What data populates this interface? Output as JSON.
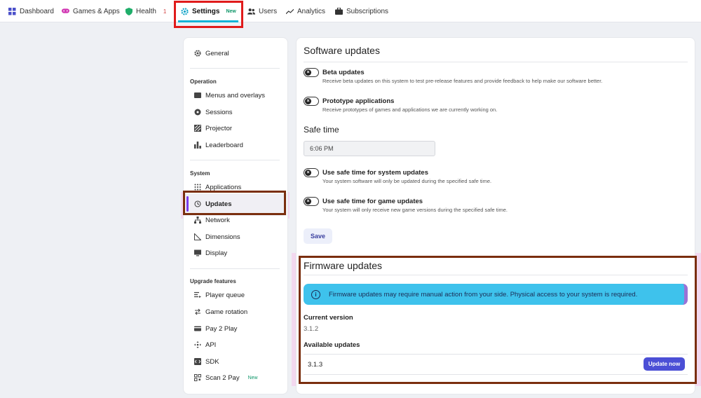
{
  "nav": {
    "items": [
      {
        "label": "Dashboard",
        "icon": "grid-icon"
      },
      {
        "label": "Games & Apps",
        "icon": "gamepad-icon"
      },
      {
        "label": "Health",
        "icon": "shield-icon",
        "count": "1"
      },
      {
        "label": "Settings",
        "icon": "gear-icon",
        "badge": "New"
      },
      {
        "label": "Users",
        "icon": "users-icon"
      },
      {
        "label": "Analytics",
        "icon": "trend-icon"
      },
      {
        "label": "Subscriptions",
        "icon": "briefcase-icon"
      }
    ]
  },
  "sidebar": {
    "general": "General",
    "sections": {
      "operation": "Operation",
      "system": "System",
      "upgrade": "Upgrade features"
    },
    "operation_items": [
      "Menus and overlays",
      "Sessions",
      "Projector",
      "Leaderboard"
    ],
    "system_items": [
      "Applications",
      "Updates",
      "Network",
      "Dimensions",
      "Display"
    ],
    "upgrade_items": [
      "Player queue",
      "Game rotation",
      "Pay 2 Play",
      "API",
      "SDK",
      "Scan 2 Pay"
    ],
    "scan_badge": "New"
  },
  "software": {
    "title": "Software updates",
    "beta_title": "Beta updates",
    "beta_desc": "Receive beta updates on this system to test pre-release features and provide feedback to help make our software better.",
    "proto_title": "Prototype applications",
    "proto_desc": "Receive prototypes of games and applications we are currently working on."
  },
  "safe_time": {
    "title": "Safe time",
    "value": "6:06 PM",
    "sys_title": "Use safe time for system updates",
    "sys_desc": "Your system software will only be updated during the specified safe time.",
    "game_title": "Use safe time for game updates",
    "game_desc": "Your system will only receive new game versions during the specified safe time.",
    "save_label": "Save"
  },
  "firmware": {
    "title": "Firmware updates",
    "info": "Firmware updates may require manual action from your side. Physical access to your system is required.",
    "current_label": "Current version",
    "current_value": "3.1.2",
    "available_label": "Available updates",
    "available_version": "3.1.3",
    "update_label": "Update now"
  },
  "colors": {
    "accent": "#4b4fd6",
    "nav_underline": "#15b3d6",
    "info_bg": "#3ec2ec",
    "active_bar": "#7c3aed"
  }
}
